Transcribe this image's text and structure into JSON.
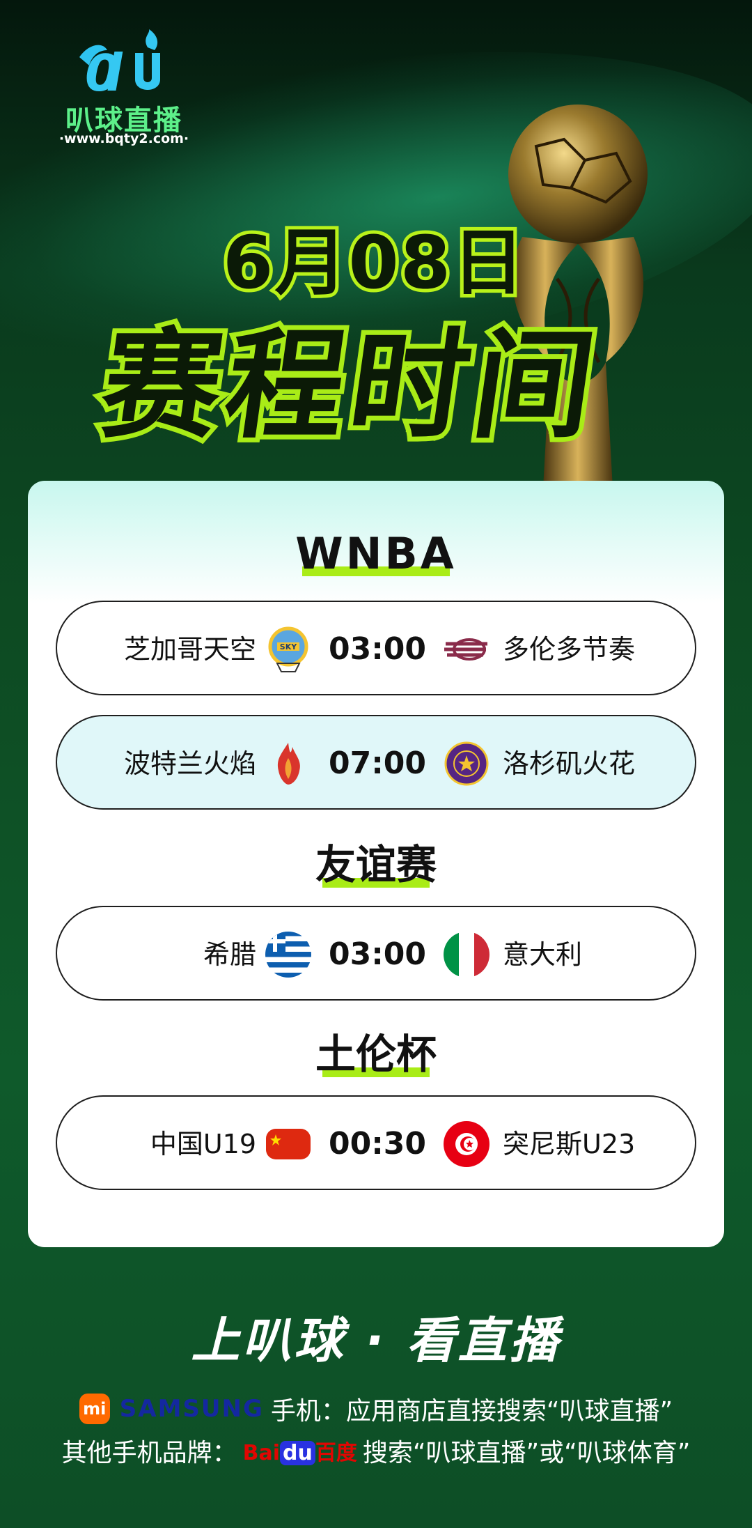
{
  "logo": {
    "name": "叭球直播",
    "url": "·www.bqty2.com·"
  },
  "header": {
    "date": "6月08日",
    "title": "赛程时间"
  },
  "sections": [
    {
      "title": "WNBA",
      "matches": [
        {
          "home": "芝加哥天空",
          "time": "03:00",
          "away": "多伦多节奏",
          "home_icon": "chicago-sky-logo-icon",
          "away_icon": "toronto-tempo-logo-icon"
        },
        {
          "home": "波特兰火焰",
          "time": "07:00",
          "away": "洛杉矶火花",
          "home_icon": "portland-fire-logo-icon",
          "away_icon": "la-sparks-logo-icon"
        }
      ]
    },
    {
      "title": "友谊赛",
      "matches": [
        {
          "home": "希腊",
          "time": "03:00",
          "away": "意大利",
          "home_icon": "greece-flag-icon",
          "away_icon": "italy-flag-icon"
        }
      ]
    },
    {
      "title": "土伦杯",
      "matches": [
        {
          "home": "中国U19",
          "time": "00:30",
          "away": "突尼斯U23",
          "home_icon": "china-flag-icon",
          "away_icon": "tunisia-flag-icon"
        }
      ]
    }
  ],
  "footer": {
    "slogan": "上叭球 · 看直播",
    "mi": "mi",
    "samsung": "SAMSUNG",
    "line1_text": "手机：应用商店直接搜索“叭球直播”",
    "line2_prefix": "其他手机品牌：",
    "baidu_1": "Bai",
    "baidu_2": "du",
    "baidu_3": "百度",
    "line2_suffix": "搜索“叭球直播”或“叭球体育”"
  },
  "colors": {
    "accent": "#a9ec17",
    "logo_green": "#5df08a",
    "bg_dark": "#04170c",
    "bg_green": "#0f5a2b"
  }
}
